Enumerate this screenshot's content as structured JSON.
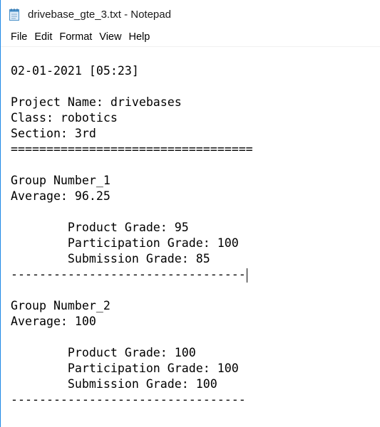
{
  "window": {
    "title": "drivebase_gte_3.txt - Notepad",
    "accent_color": "#1e88e5"
  },
  "menu": {
    "items": [
      {
        "label": "File"
      },
      {
        "label": "Edit"
      },
      {
        "label": "Format"
      },
      {
        "label": "View"
      },
      {
        "label": "Help"
      }
    ]
  },
  "document": {
    "lines": [
      "02-01-2021 [05:23]",
      "",
      "Project Name: drivebases",
      "Class: robotics",
      "Section: 3rd",
      "==================================",
      "",
      "Group Number_1",
      "Average: 96.25",
      "",
      "        Product Grade: 95",
      "        Participation Grade: 100",
      "        Submission Grade: 85",
      "---------------------------------",
      "",
      "Group Number_2",
      "Average: 100",
      "",
      "        Product Grade: 100",
      "        Participation Grade: 100",
      "        Submission Grade: 100",
      "---------------------------------"
    ],
    "caret_line_index": 13
  }
}
